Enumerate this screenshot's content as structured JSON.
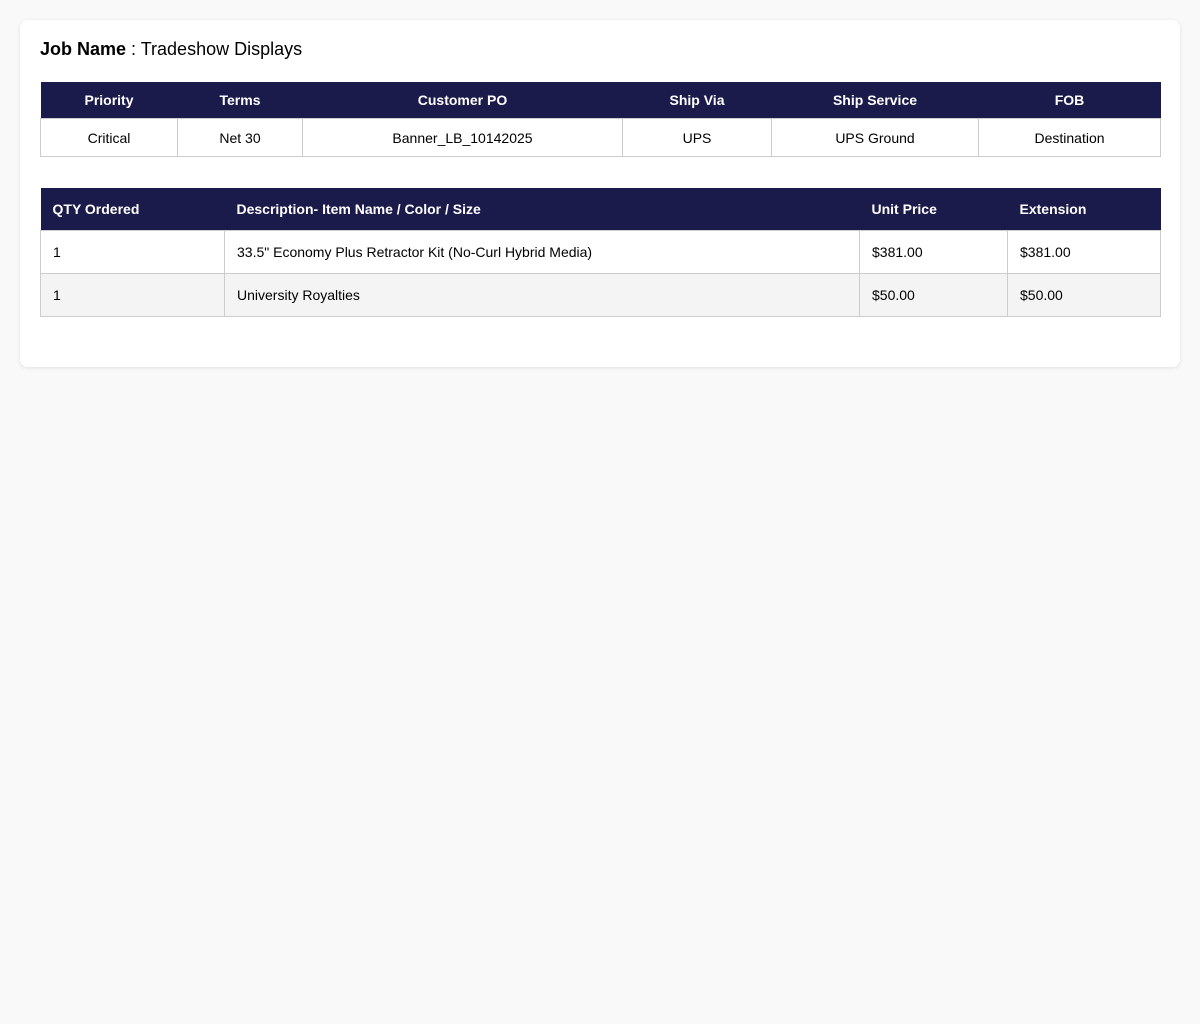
{
  "job": {
    "label": "Job Name",
    "separator": " : ",
    "value": "Tradeshow Displays"
  },
  "shipping": {
    "headers": [
      "Priority",
      "Terms",
      "Customer PO",
      "Ship Via",
      "Ship Service",
      "FOB"
    ],
    "values": [
      "Critical",
      "Net 30",
      "Banner_LB_10142025",
      "UPS",
      "UPS Ground",
      "Destination"
    ]
  },
  "items": {
    "headers": [
      "QTY Ordered",
      "Description- Item Name / Color / Size",
      "Unit Price",
      "Extension"
    ],
    "rows": [
      [
        "1",
        "33.5\" Economy Plus Retractor Kit (No-Curl Hybrid Media)",
        "$381.00",
        "$381.00"
      ],
      [
        "1",
        "University Royalties",
        "$50.00",
        "$50.00"
      ]
    ]
  },
  "colors": {
    "header_bg": "#1b1b4b",
    "page_bg": "#f9f9f9",
    "alt_row_bg": "#f4f4f4"
  }
}
